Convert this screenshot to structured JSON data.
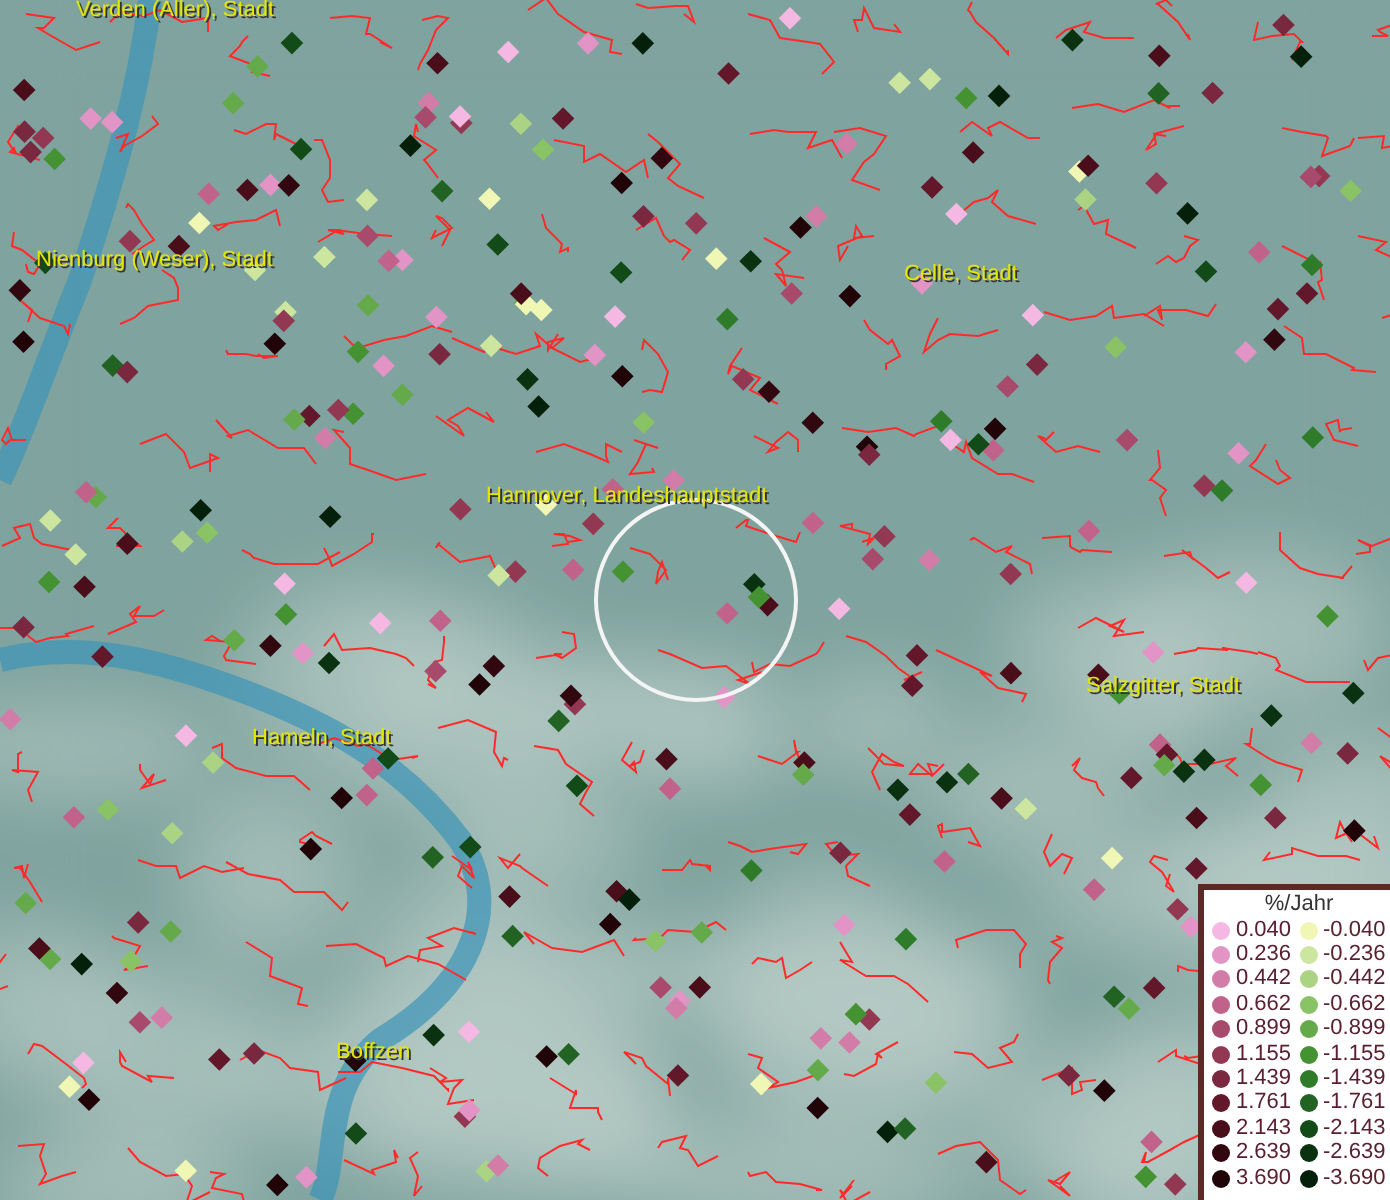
{
  "map": {
    "place_labels": [
      "Verden (Aller), Stadt",
      "Nienburg (Weser), Stadt",
      "Celle, Stadt",
      "Hannover, Landeshauptstadt",
      "Salzgitter, Stadt",
      "Hameln, Stadt",
      "Boffzen"
    ]
  },
  "legend": {
    "title": "%/Jahr",
    "positive": [
      {
        "label": "0.040",
        "color": "#f4b8e2"
      },
      {
        "label": "0.236",
        "color": "#e394c6"
      },
      {
        "label": "0.442",
        "color": "#d27ca8"
      },
      {
        "label": "0.662",
        "color": "#c0628a"
      },
      {
        "label": "0.899",
        "color": "#a84a6c"
      },
      {
        "label": "1.155",
        "color": "#923852"
      },
      {
        "label": "1.439",
        "color": "#7a2840"
      },
      {
        "label": "1.761",
        "color": "#62182a"
      },
      {
        "label": "2.143",
        "color": "#4a0e1a"
      },
      {
        "label": "2.639",
        "color": "#320810"
      },
      {
        "label": "3.690",
        "color": "#200408"
      }
    ],
    "negative": [
      {
        "label": "-0.040",
        "color": "#f0f6b4"
      },
      {
        "label": "-0.236",
        "color": "#cce6a0"
      },
      {
        "label": "-0.442",
        "color": "#aad384"
      },
      {
        "label": "-0.662",
        "color": "#8ac266"
      },
      {
        "label": "-0.899",
        "color": "#64aa4a"
      },
      {
        "label": "-1.155",
        "color": "#449232"
      },
      {
        "label": "-1.439",
        "color": "#2e7c2a"
      },
      {
        "label": "-1.761",
        "color": "#226222"
      },
      {
        "label": "-2.143",
        "color": "#124a18"
      },
      {
        "label": "-2.639",
        "color": "#0a3210"
      },
      {
        "label": "-3.690",
        "color": "#04200a"
      }
    ]
  }
}
